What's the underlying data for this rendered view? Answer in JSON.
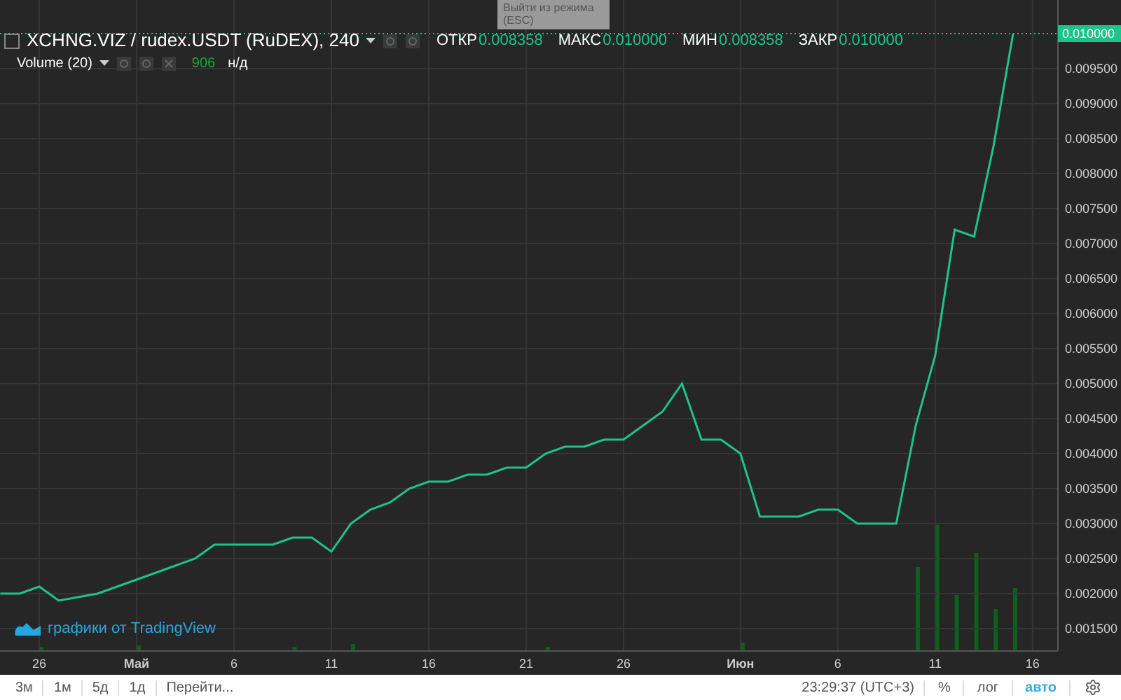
{
  "tooltip": {
    "text": "Выйти из режима (ESC)"
  },
  "legend": {
    "title": "XCHNG.VIZ / rudex.USDT (RuDEX), 240",
    "ohlc": [
      {
        "label": "ОТКР",
        "value": "0.008358"
      },
      {
        "label": "МАКС",
        "value": "0.010000"
      },
      {
        "label": "МИН",
        "value": "0.008358"
      },
      {
        "label": "ЗАКР",
        "value": "0.010000"
      }
    ]
  },
  "volume_legend": {
    "title": "Volume (20)",
    "value": "906",
    "value_2": "н/д"
  },
  "chart": {
    "last_price_label": "0.010000",
    "chart_data": {
      "type": "line",
      "grid": true,
      "ylim": [
        0.00118,
        0.01048
      ],
      "categories": [
        null,
        null,
        "26",
        null,
        null,
        null,
        null,
        "Май",
        null,
        null,
        null,
        null,
        "6",
        null,
        null,
        null,
        null,
        "11",
        null,
        null,
        null,
        null,
        "16",
        null,
        null,
        null,
        null,
        "21",
        null,
        null,
        null,
        null,
        "26",
        null,
        null,
        null,
        null,
        null,
        "Июн",
        null,
        null,
        null,
        null,
        "6",
        null,
        null,
        null,
        null,
        "11",
        null,
        null,
        null,
        null,
        "16",
        null
      ],
      "series": [
        {
          "color": "#1fc28a",
          "values": [
            0.002,
            0.002,
            0.0021,
            0.0019,
            0.00195,
            0.002,
            0.0021,
            0.0022,
            0.0023,
            0.0024,
            0.0025,
            0.0027,
            0.0027,
            0.0027,
            0.0027,
            0.0028,
            0.0028,
            0.0026,
            0.003,
            0.0032,
            0.0033,
            0.0035,
            0.0036,
            0.0036,
            0.0037,
            0.0037,
            0.0038,
            0.0038,
            0.004,
            0.0041,
            0.0041,
            0.0042,
            0.0042,
            0.0044,
            0.0046,
            0.005,
            0.0042,
            0.0042,
            0.004,
            0.0031,
            0.0031,
            0.0031,
            0.0032,
            0.0032,
            0.003,
            0.003,
            0.003,
            0.0044,
            0.0054,
            0.0072,
            0.0071,
            0.0084,
            0.01,
            null,
            null
          ]
        }
      ],
      "yticks": [
        {
          "value": 0.0095,
          "label": "0.009500"
        },
        {
          "value": 0.009,
          "label": "0.009000"
        },
        {
          "value": 0.0085,
          "label": "0.008500"
        },
        {
          "value": 0.008,
          "label": "0.008000"
        },
        {
          "value": 0.0075,
          "label": "0.007500"
        },
        {
          "value": 0.007,
          "label": "0.007000"
        },
        {
          "value": 0.0065,
          "label": "0.006500"
        },
        {
          "value": 0.006,
          "label": "0.006000"
        },
        {
          "value": 0.0055,
          "label": "0.005500"
        },
        {
          "value": 0.005,
          "label": "0.005000"
        },
        {
          "value": 0.0045,
          "label": "0.004500"
        },
        {
          "value": 0.004,
          "label": "0.004000"
        },
        {
          "value": 0.0035,
          "label": "0.003500"
        },
        {
          "value": 0.003,
          "label": "0.003000"
        },
        {
          "value": 0.0025,
          "label": "0.002500"
        },
        {
          "value": 0.002,
          "label": "0.002000"
        },
        {
          "value": 0.0015,
          "label": "0.001500"
        }
      ]
    }
  },
  "attribution": {
    "text": "графики от TradingView"
  },
  "bottom_bar": {
    "ranges": [
      "3м",
      "1м",
      "5д",
      "1д"
    ],
    "goto": "Перейти...",
    "time": "23:29:37 (UTC+3)",
    "toggles": [
      {
        "label": "%",
        "selected": false
      },
      {
        "label": "лог",
        "selected": false
      },
      {
        "label": "авто",
        "selected": true
      }
    ]
  }
}
